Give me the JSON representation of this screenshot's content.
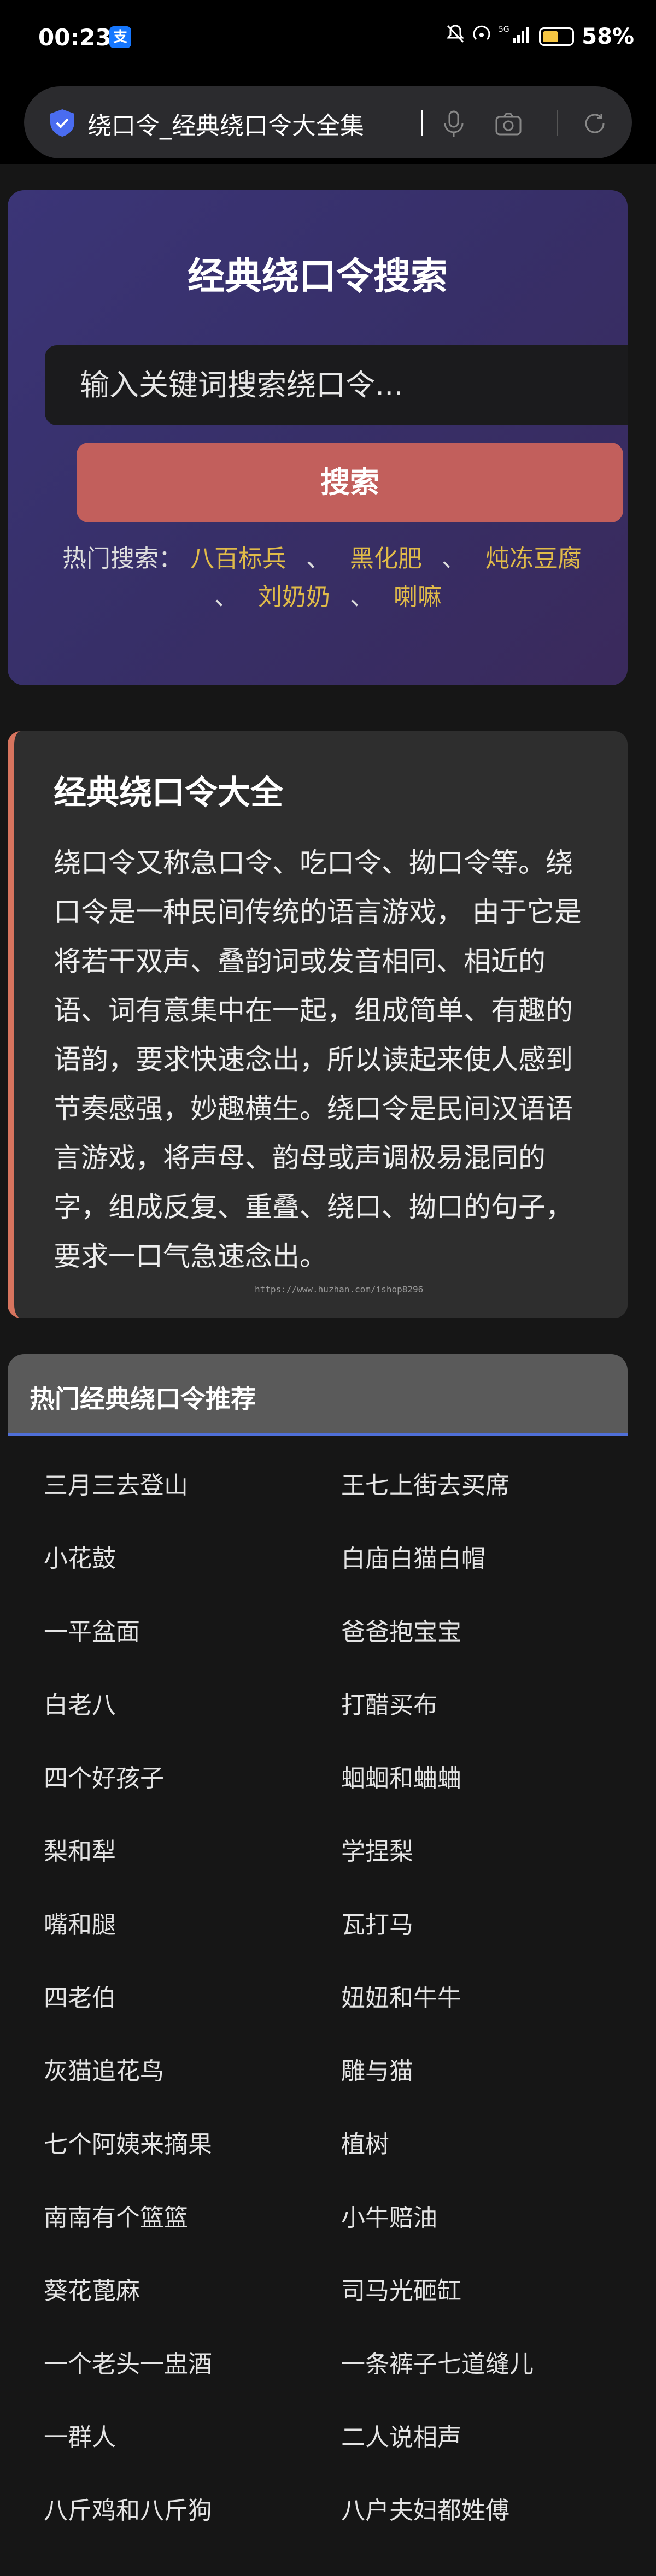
{
  "status_bar": {
    "time": "00:23",
    "alipay_icon_label": "支",
    "icons": [
      "mute-icon",
      "hotspot-icon",
      "signal-icon"
    ],
    "network": "5G",
    "battery": "58%"
  },
  "browser": {
    "address_text": "绕口令_经典绕口令大全集"
  },
  "hero": {
    "title": "经典绕口令搜索",
    "search_placeholder": "输入关键词搜索绕口令...",
    "search_button": "搜索",
    "hot_label": "热门搜索：",
    "hot_links": [
      "八百标兵",
      "黑化肥",
      "炖冻豆腐",
      "刘奶奶",
      "喇嘛"
    ],
    "separator": "、"
  },
  "intro": {
    "title": "经典绕口令大全",
    "text": "绕口令又称急口令、吃口令、拗口令等。绕口令是一种民间传统的语言游戏， 由于它是将若干双声、叠韵词或发音相同、相近的语、词有意集中在一起，组成简单、有趣的语韵，要求快速念出，所以读起来使人感到节奏感强，妙趣横生。绕口令是民间汉语语言游戏，将声母、韵母或声调极易混同的字，组成反复、重叠、绕口、拗口的句子，要求一口气急速念出。",
    "watermark": "https://www.huzhan.com/ishop8296"
  },
  "recommend": {
    "header": "热门经典绕口令推荐",
    "items": [
      "三月三去登山",
      "王七上街去买席",
      "小花鼓",
      "白庙白猫白帽",
      "一平盆面",
      "爸爸抱宝宝",
      "白老八",
      "打醋买布",
      "四个好孩子",
      "蛔蛔和蛐蛐",
      "梨和犁",
      "学捏梨",
      "嘴和腿",
      "瓦打马",
      "四老伯",
      "妞妞和牛牛",
      "灰猫追花鸟",
      "雕与猫",
      "七个阿姨来摘果",
      "植树",
      "南南有个篮篮",
      "小牛赔油",
      "葵花蓖麻",
      "司马光砸缸",
      "一个老头一盅酒",
      "一条裤子七道缝儿",
      "一群人",
      "二人说相声",
      "八斤鸡和八斤狗",
      "八户夫妇都姓傅"
    ]
  },
  "colors": {
    "accent_red": "#c25f5c",
    "hot_link": "#e0bb49",
    "intro_border": "#d7745e",
    "header_underline": "#4f6fd8"
  }
}
